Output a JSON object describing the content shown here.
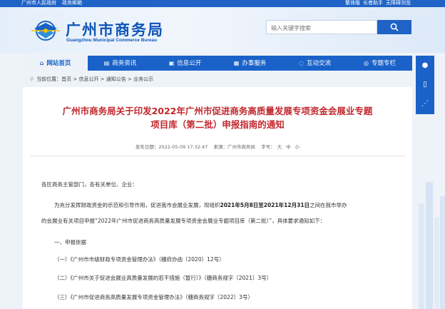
{
  "topbar": {
    "links_left": [
      "广州市人民政府",
      "政务邮箱"
    ],
    "links_right": [
      "繁体版",
      "长者助手",
      "无障碍浏览"
    ]
  },
  "header": {
    "title": "广州市商务局",
    "subtitle": "Guangzhou Municipal Commerce Bureau",
    "search_placeholder": "输入关键字搜索"
  },
  "nav": [
    {
      "icon": "home-icon",
      "label": "网站首页",
      "active": true
    },
    {
      "icon": "news-icon",
      "label": "商务资讯"
    },
    {
      "icon": "info-icon",
      "label": "信息公开"
    },
    {
      "icon": "service-icon",
      "label": "办事服务"
    },
    {
      "icon": "chat-icon",
      "label": "互动交流"
    },
    {
      "icon": "topic-icon",
      "label": "专题专栏"
    }
  ],
  "breadcrumb": "当前位置：首页 > 信息公开 > 通知公告 > 业务公示",
  "article": {
    "title_line1": "广州市商务局关于印发2022年广州市促进商务高质量发展专项资金会展业专题",
    "title_line2": "项目库（第二批）申报指南的通知",
    "meta_date": "发布日期：2022-05-09 17:32:47",
    "meta_source": "来源：广州市商务局",
    "meta_size_label": "字号：",
    "meta_sizes": [
      "大",
      "中",
      "小"
    ],
    "greeting": "各区商务主管部门，各有关单位、企业：",
    "para1_a": "为充分发挥财政资金的示范和引导作用，促进我市会展业发展，现组织",
    "para1_bold": "2021年5月8日至2021年12月31日",
    "para1_b": "之间在我市举办",
    "para2": "的会展业有关项目申报“2022年广州市促进商务高质量发展专项资金会展业专题项目库（第二批）”，具体要求通知如下：",
    "section1": "一、申报依据",
    "item1": "（一）《广州市市级财政专项资金管理办法》（穗府办函〔2020〕12号）",
    "item2": "（二）《广州市关于促进会展业高质量发展的若干措施（暂行）》（穗商务规字〔2021〕3号）",
    "item3": "（三）《广州市促进商务高质量发展专项资金管理办法》（穗商务规字〔2022〕3号）"
  },
  "colors": {
    "brand_blue": "#1a62c8",
    "title_red": "#c1272d"
  }
}
